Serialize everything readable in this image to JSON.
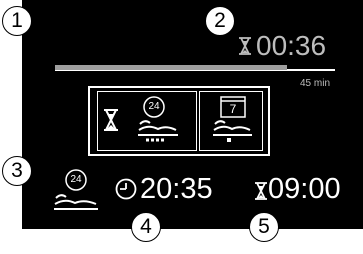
{
  "colors": {
    "background": "#000000",
    "foreground": "#ffffff",
    "inactive": "#bdbdbd",
    "progress_track": "#ffffff",
    "progress_fill": "#9e9e9e"
  },
  "callouts": [
    "1",
    "2",
    "3",
    "4",
    "5"
  ],
  "timer": {
    "icon": "hourglass-icon",
    "remaining": "00:36",
    "progress_fraction": 0.83,
    "duration_label": "45 min"
  },
  "programs": [
    {
      "icon": "hourglass-icon",
      "selected": true
    },
    {
      "icon": "timer-24h-bed-icon",
      "badge": "24",
      "selected": true
    },
    {
      "icon": "weekly-bed-icon",
      "badge": "7",
      "selected": false
    }
  ],
  "status": {
    "program_icon": "timer-24h-bed-icon",
    "program_badge": "24",
    "clock_icon": "clock-icon",
    "clock_time": "20:35",
    "end_icon": "hourglass-icon",
    "end_time": "09:00"
  }
}
